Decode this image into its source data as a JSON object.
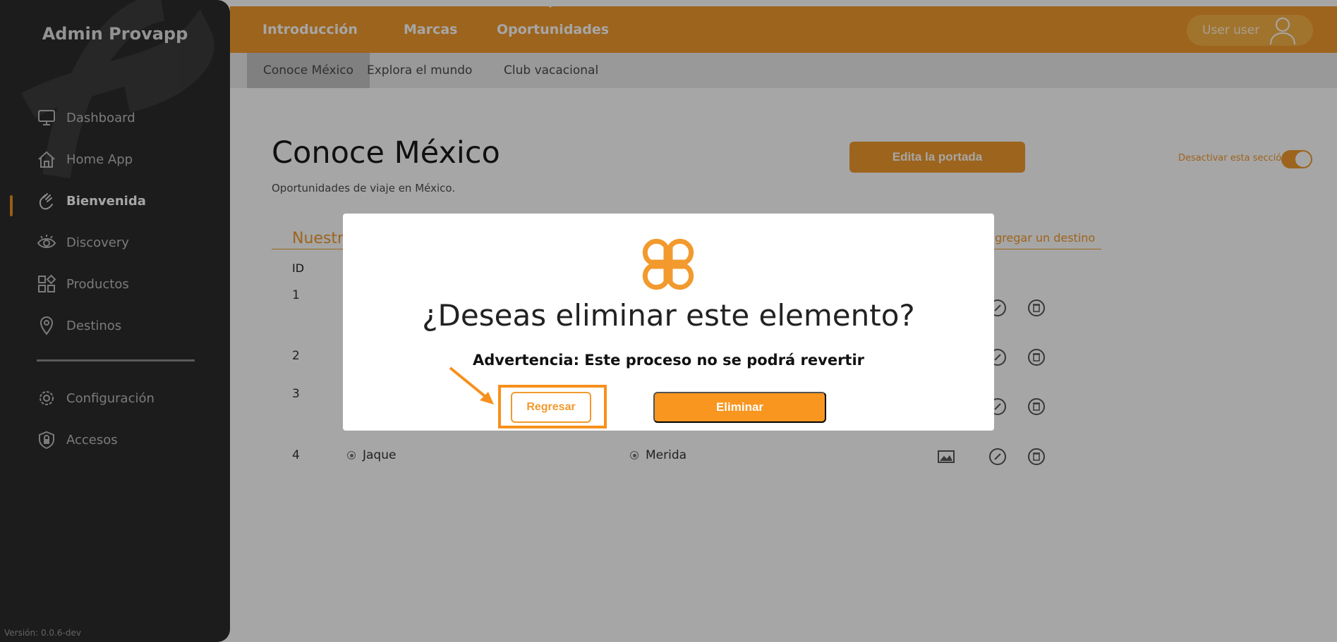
{
  "sidebar": {
    "app_title": "Admin Provapp",
    "items": [
      {
        "label": "Dashboard",
        "icon": "monitor-icon"
      },
      {
        "label": "Home App",
        "icon": "home-icon"
      },
      {
        "label": "Bienvenida",
        "icon": "waving-hand-icon",
        "active": true
      },
      {
        "label": "Discovery",
        "icon": "eye-icon"
      },
      {
        "label": "Productos",
        "icon": "grid-icon"
      },
      {
        "label": "Destinos",
        "icon": "location-pin-icon"
      },
      {
        "label": "Configuración",
        "icon": "gear-icon"
      },
      {
        "label": "Accesos",
        "icon": "shield-lock-icon"
      }
    ],
    "version": "Versión: 0.0.6-dev"
  },
  "topbar": {
    "tabs": [
      "Introducción",
      "Marcas",
      "Oportunidades"
    ],
    "active_tab": "Oportunidades",
    "user_name": "User user"
  },
  "subnav": {
    "tabs": [
      "Conoce México",
      "Explora el mundo",
      "Club vacacional"
    ],
    "active_tab": "Conoce México"
  },
  "page": {
    "title": "Conoce México",
    "subtitle": "Oportunidades de viaje en México.",
    "edit_button": "Edita la portada",
    "toggle_label": "Desactivar esta sección",
    "toggle_on": true,
    "section_title": "Nuestr",
    "add_link": "gregar un destino",
    "col_id": "ID",
    "rows": [
      {
        "id": "1",
        "name": "",
        "city": ""
      },
      {
        "id": "2",
        "name": "",
        "city": ""
      },
      {
        "id": "3",
        "name": "",
        "city": ""
      },
      {
        "id": "4",
        "name": "Jaque",
        "city": "Merida"
      }
    ]
  },
  "modal": {
    "title": "¿Deseas eliminar este elemento?",
    "warning": "Advertencia: Este proceso no se podrá revertir",
    "back_button": "Regresar",
    "delete_button": "Eliminar"
  },
  "colors": {
    "accent": "#f29a2d",
    "sidebar_bg": "#2b2b2b",
    "highlight": "#f7901c"
  }
}
